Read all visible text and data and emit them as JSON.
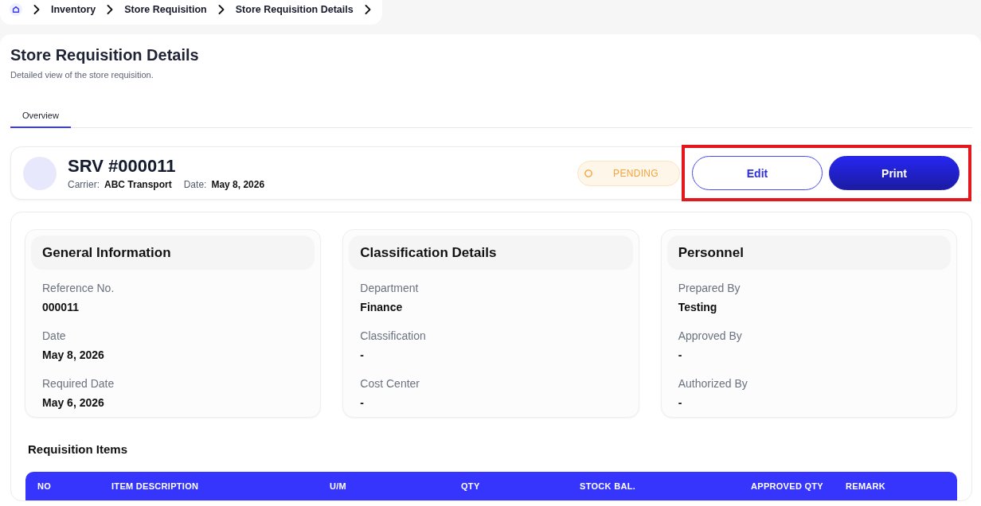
{
  "breadcrumb": [
    {
      "label": "Inventory"
    },
    {
      "label": "Store Requisition"
    },
    {
      "label": "Store Requisition Details"
    }
  ],
  "page": {
    "title": "Store Requisition Details",
    "subtitle": "Detailed view of the store requisition."
  },
  "tabs": [
    {
      "label": "Overview",
      "selected": true
    }
  ],
  "record": {
    "title": "SRV #000011",
    "meta": [
      {
        "label": "Carrier:",
        "value": "ABC Transport"
      },
      {
        "label": "Date:",
        "value": "May 8, 2026"
      }
    ],
    "status": {
      "label": "PENDING",
      "kind": "pending"
    },
    "actions": {
      "highlighted": true,
      "buttons": [
        {
          "label": "Edit",
          "kind": "edit"
        },
        {
          "label": "Print",
          "kind": "print"
        }
      ]
    }
  },
  "sections": [
    {
      "title": "General Information",
      "fields": [
        {
          "label": "Reference No.",
          "value": "000011"
        },
        {
          "label": "Date",
          "value": "May 8, 2026"
        },
        {
          "label": "Required Date",
          "value": "May 6, 2026"
        }
      ]
    },
    {
      "title": "Classification Details",
      "fields": [
        {
          "label": "Department",
          "value": "Finance"
        },
        {
          "label": "Classification",
          "value": "-"
        },
        {
          "label": "Cost Center",
          "value": "-"
        }
      ]
    },
    {
      "title": "Personnel",
      "fields": [
        {
          "label": "Prepared By",
          "value": "Testing"
        },
        {
          "label": "Approved By",
          "value": "-"
        },
        {
          "label": "Authorized By",
          "value": "-"
        }
      ]
    }
  ],
  "items_table": {
    "title": "Requisition Items",
    "columns": [
      "NO",
      "ITEM DESCRIPTION",
      "U/M",
      "QTY",
      "STOCK BAL.",
      "APPROVED QTY",
      "REMARK"
    ]
  }
}
